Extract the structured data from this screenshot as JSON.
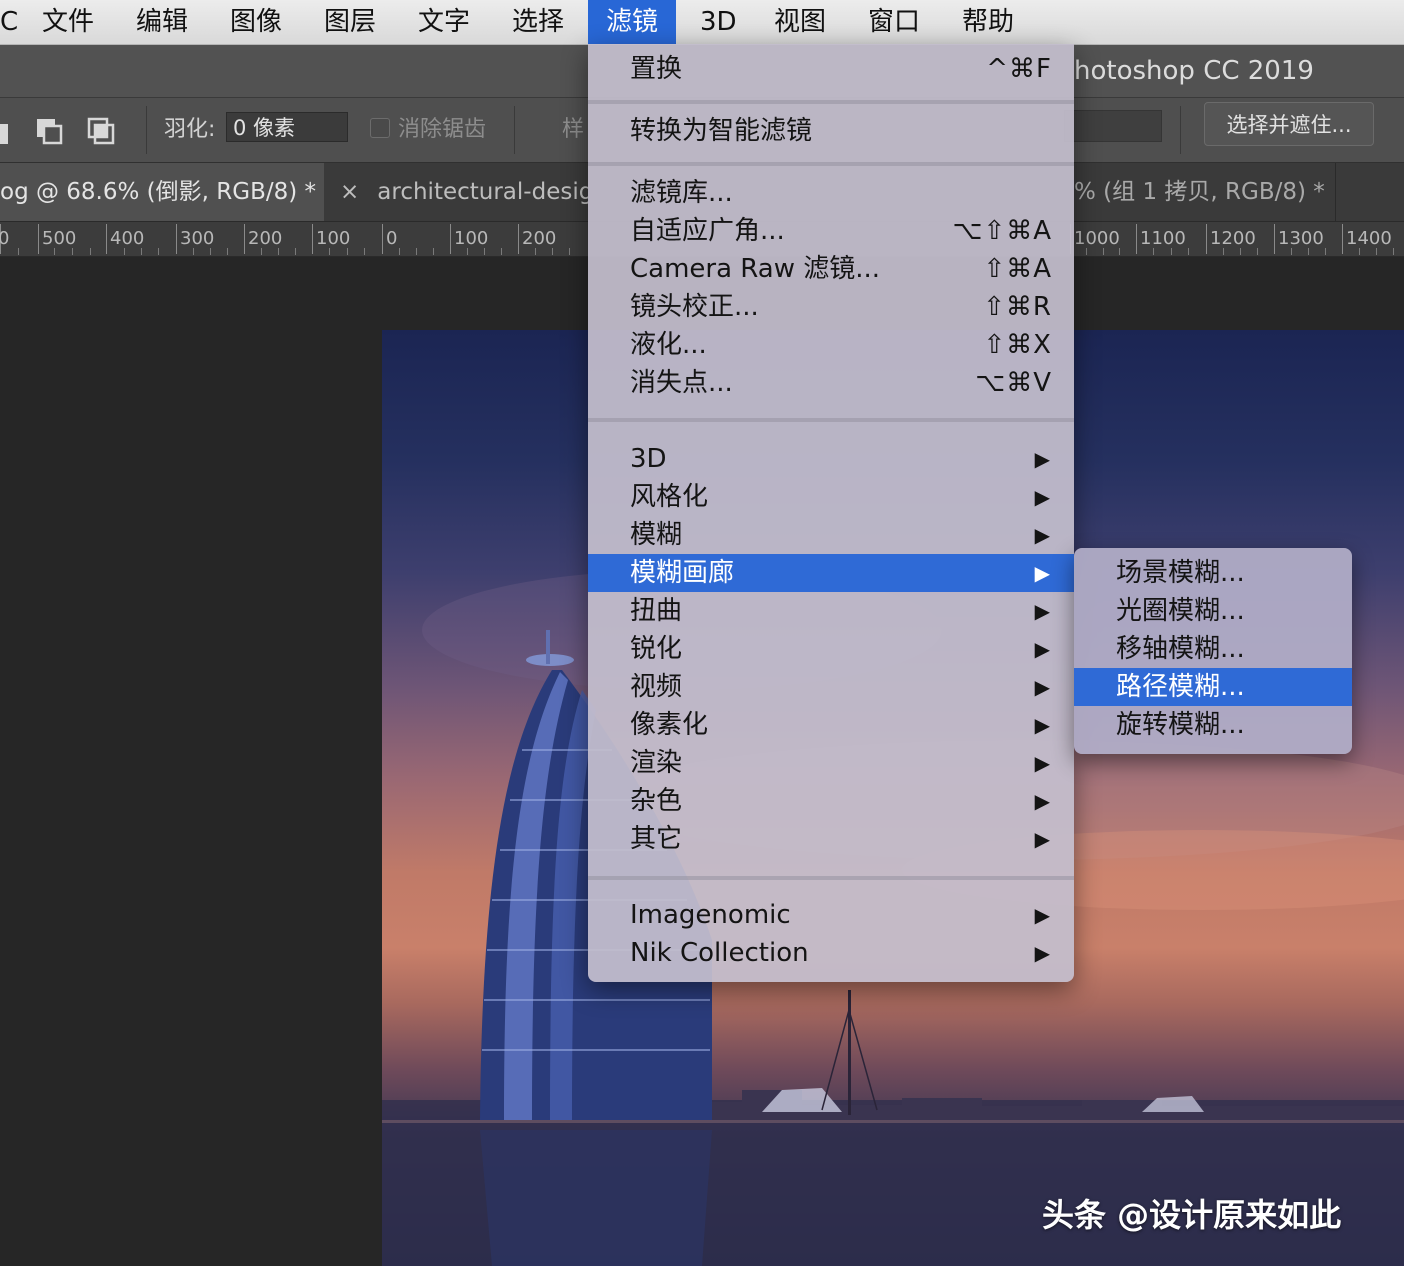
{
  "menubar": {
    "app_fragment": "C",
    "items": [
      "文件",
      "编辑",
      "图像",
      "图层",
      "文字",
      "选择",
      "滤镜",
      "3D",
      "视图",
      "窗口",
      "帮助"
    ],
    "active_index": 6
  },
  "titlebar": {
    "title": "hotoshop CC 2019"
  },
  "options_bar": {
    "feather_label": "羽化:",
    "feather_value": "0 像素",
    "antialias_label": "消除锯齿",
    "style_label": "样",
    "select_mask_button": "选择并遮住..."
  },
  "tabs": {
    "active": "og @ 68.6% (倒影, RGB/8) *",
    "close_glyph": "×",
    "second": "architectural-design",
    "third": "% (组 1 拷贝, RGB/8) *"
  },
  "ruler": {
    "labels": [
      "0",
      "500",
      "400",
      "300",
      "200",
      "100",
      "0",
      "100",
      "200",
      "1000",
      "1100",
      "1200",
      "1300",
      "1400"
    ]
  },
  "filter_menu": {
    "items": [
      {
        "label": "置换",
        "shortcut": "^⌘F"
      },
      {
        "label": "转换为智能滤镜",
        "shortcut": ""
      },
      {
        "label": "滤镜库...",
        "shortcut": ""
      },
      {
        "label": "自适应广角...",
        "shortcut": "⌥⇧⌘A"
      },
      {
        "label": "Camera Raw 滤镜...",
        "shortcut": "⇧⌘A"
      },
      {
        "label": "镜头校正...",
        "shortcut": "⇧⌘R"
      },
      {
        "label": "液化...",
        "shortcut": "⇧⌘X"
      },
      {
        "label": "消失点...",
        "shortcut": "⌥⌘V"
      },
      {
        "label": "3D",
        "arrow": "▶"
      },
      {
        "label": "风格化",
        "arrow": "▶"
      },
      {
        "label": "模糊",
        "arrow": "▶"
      },
      {
        "label": "模糊画廊",
        "arrow": "▶"
      },
      {
        "label": "扭曲",
        "arrow": "▶"
      },
      {
        "label": "锐化",
        "arrow": "▶"
      },
      {
        "label": "视频",
        "arrow": "▶"
      },
      {
        "label": "像素化",
        "arrow": "▶"
      },
      {
        "label": "渲染",
        "arrow": "▶"
      },
      {
        "label": "杂色",
        "arrow": "▶"
      },
      {
        "label": "其它",
        "arrow": "▶"
      },
      {
        "label": "Imagenomic",
        "arrow": "▶"
      },
      {
        "label": "Nik Collection",
        "arrow": "▶"
      }
    ],
    "highlighted": "模糊画廊"
  },
  "blur_gallery_submenu": {
    "items": [
      "场景模糊...",
      "光圈模糊...",
      "移轴模糊...",
      "路径模糊...",
      "旋转模糊..."
    ],
    "highlighted": "路径模糊..."
  },
  "watermark": "头条 @设计原来如此",
  "colors": {
    "menu_highlight": "#2f6ad6",
    "menubar_active": "#2867d6",
    "canvas_bg": "#262626"
  }
}
